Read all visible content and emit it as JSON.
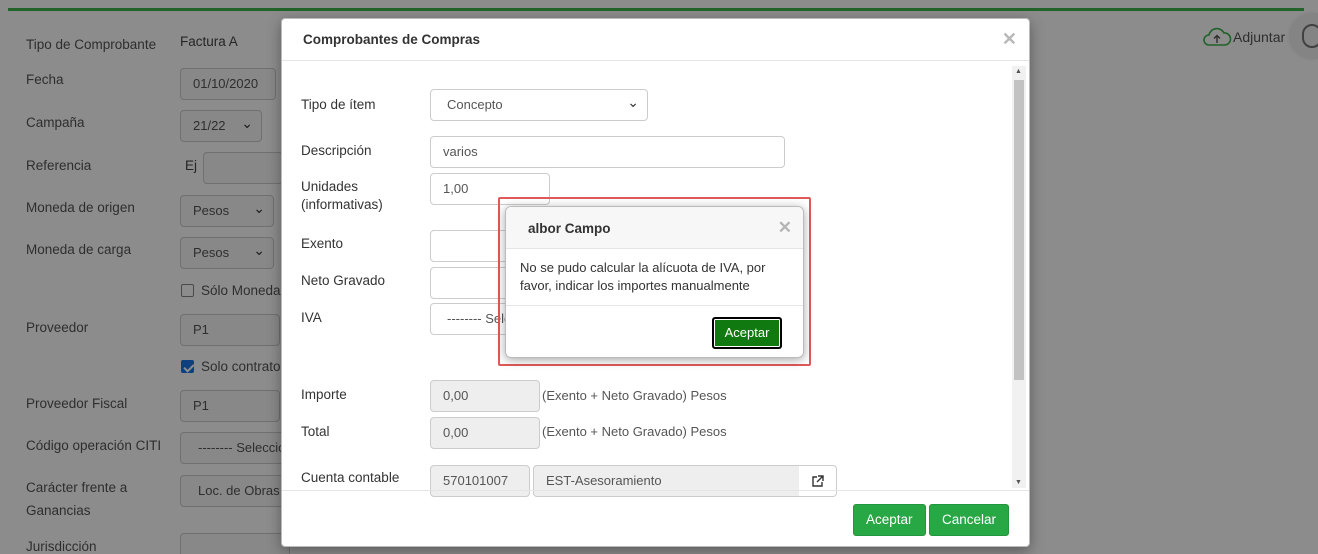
{
  "background": {
    "accent_color": "#3cb44b",
    "labels": {
      "tipo_comprobante": "Tipo de Comprobante",
      "fecha": "Fecha",
      "campana": "Campaña",
      "referencia": "Referencia",
      "moneda_origen": "Moneda de origen",
      "moneda_carga": "Moneda de carga",
      "proveedor": "Proveedor",
      "proveedor_fiscal": "Proveedor Fiscal",
      "codigo_citi": "Código operación CITI",
      "caracter_line1": "Carácter frente a",
      "caracter_line2": "Ganancias",
      "jurisdiccion": "Jurisdicción"
    },
    "values": {
      "tipo_comprobante": "Factura A",
      "fecha": "01/10/2020",
      "campana": "21/22",
      "referencia_prefix": "Ej",
      "moneda_origen": "Pesos",
      "moneda_carga": "Pesos",
      "solo_moneda": "Sólo Moneda",
      "proveedor": "P1",
      "solo_contrato": "Solo contrato",
      "proveedor_fiscal": "P1",
      "codigo_citi": "-------- Seleccion",
      "caracter": "Loc. de Obras"
    },
    "adjuntar": "Adjuntar"
  },
  "modal": {
    "title": "Comprobantes de Compras",
    "labels": {
      "tipo_item": "Tipo de ítem",
      "descripcion": "Descripción",
      "unidades_line1": "Unidades",
      "unidades_line2": "(informativas)",
      "exento": "Exento",
      "neto_gravado": "Neto Gravado",
      "iva": "IVA",
      "importe": "Importe",
      "total": "Total",
      "cuenta_contable": "Cuenta contable"
    },
    "values": {
      "tipo_item": "Concepto",
      "descripcion": "varios",
      "unidades": "1,00",
      "iva_select": "-------- Sele",
      "importe": "0,00",
      "total": "0,00",
      "cuenta_codigo": "570101007",
      "cuenta_nombre": "EST-Asesoramiento"
    },
    "notes": {
      "importe": "(Exento + Neto Gravado)  Pesos",
      "total": "(Exento + Neto Gravado)  Pesos"
    },
    "footer": {
      "accept": "Aceptar",
      "cancel": "Cancelar"
    }
  },
  "alert": {
    "title": "albor Campo",
    "message": "No se pudo calcular la alícuota de IVA, por favor, indicar los importes manualmente",
    "ok": "Aceptar",
    "ok_color": "#107a10",
    "highlight_color": "#e05a5a"
  }
}
